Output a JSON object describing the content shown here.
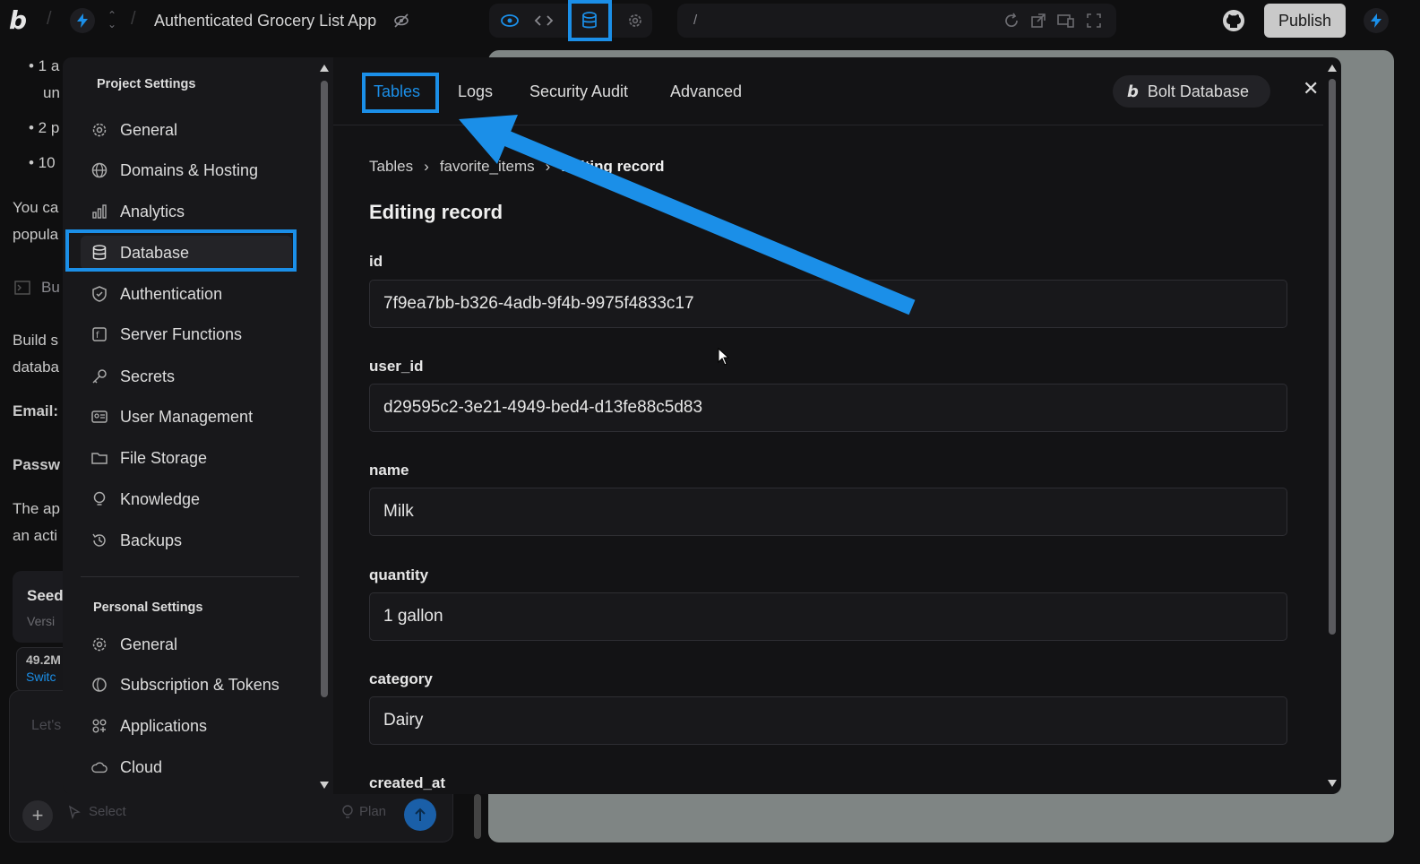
{
  "header": {
    "logo": "b",
    "project_title": "Authenticated Grocery List App",
    "url_path": "/",
    "publish_label": "Publish"
  },
  "chat": {
    "lines": [
      "• 1 a",
      "un",
      "• 2 p",
      "• 10",
      "You ca",
      "popula",
      "Bu",
      "Build s",
      "databa",
      "Email:",
      "Passw",
      "The ap",
      "an acti"
    ],
    "seed_title": "Seed",
    "seed_sub": "Versi",
    "size": "49.2M",
    "switch": "Switc",
    "input_placeholder": "Let's",
    "select_label": "Select",
    "plan_label": "Plan"
  },
  "sidebar": {
    "project_section": "Project Settings",
    "project_items": [
      {
        "label": "General",
        "icon": "gear-icon"
      },
      {
        "label": "Domains & Hosting",
        "icon": "globe-icon"
      },
      {
        "label": "Analytics",
        "icon": "bar-chart-icon"
      },
      {
        "label": "Database",
        "icon": "database-icon"
      },
      {
        "label": "Authentication",
        "icon": "shield-icon"
      },
      {
        "label": "Server Functions",
        "icon": "function-icon"
      },
      {
        "label": "Secrets",
        "icon": "key-icon"
      },
      {
        "label": "User Management",
        "icon": "id-card-icon"
      },
      {
        "label": "File Storage",
        "icon": "folder-icon"
      },
      {
        "label": "Knowledge",
        "icon": "lightbulb-icon"
      },
      {
        "label": "Backups",
        "icon": "history-icon"
      }
    ],
    "personal_section": "Personal Settings",
    "personal_items": [
      {
        "label": "General",
        "icon": "gear-icon"
      },
      {
        "label": "Subscription & Tokens",
        "icon": "token-icon"
      },
      {
        "label": "Applications",
        "icon": "apps-icon"
      },
      {
        "label": "Cloud",
        "icon": "cloud-icon"
      }
    ]
  },
  "panel": {
    "tabs": [
      "Tables",
      "Logs",
      "Security Audit",
      "Advanced"
    ],
    "active_tab": "Tables",
    "bolt_db_label": "Bolt Database",
    "breadcrumb": [
      "Tables",
      "favorite_items",
      "Editing record"
    ],
    "title": "Editing record",
    "fields": [
      {
        "label": "id",
        "value": "7f9ea7bb-b326-4adb-9f4b-9975f4833c17"
      },
      {
        "label": "user_id",
        "value": "d29595c2-3e21-4949-bed4-d13fe88c5d83"
      },
      {
        "label": "name",
        "value": "Milk"
      },
      {
        "label": "quantity",
        "value": "1 gallon"
      },
      {
        "label": "category",
        "value": "Dairy"
      },
      {
        "label": "created_at",
        "value": ""
      }
    ]
  },
  "colors": {
    "accent": "#1b8fe8",
    "background": "#0f0f10",
    "panel": "#131315",
    "sidebar": "#18181b",
    "preview": "#7f8584"
  }
}
